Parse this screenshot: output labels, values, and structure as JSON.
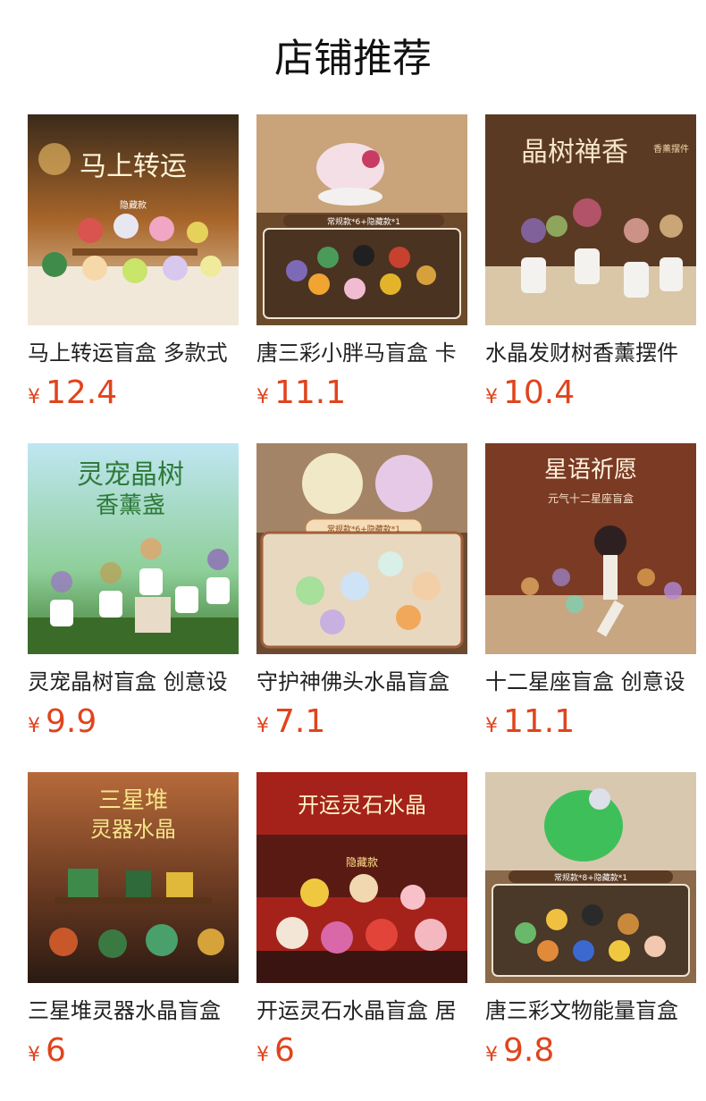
{
  "section": {
    "title": "店铺推荐"
  },
  "currency_symbol": "¥",
  "colors": {
    "price": "#e0441d",
    "title": "#111111",
    "name": "#222222"
  },
  "products": [
    {
      "name": "马上转运盲盒 多款式",
      "price": "12.4",
      "image_alt": "马上转运",
      "image_caption": "隐藏款",
      "image_icon": "horse-figurines-image"
    },
    {
      "name": "唐三彩小胖马盲盒 卡",
      "price": "11.1",
      "image_alt": "",
      "image_caption": "常规款*6+隐藏款*1",
      "image_icon": "tang-horse-figurines-image"
    },
    {
      "name": "水晶发财树香薰摆件",
      "price": "10.4",
      "image_alt": "晶树禅香",
      "image_caption": "香薰摆件",
      "image_icon": "crystal-tree-image"
    },
    {
      "name": "灵宠晶树盲盒 创意设",
      "price": "9.9",
      "image_alt": "灵宠晶树",
      "image_caption": "香薰盏",
      "image_icon": "pet-crystal-tree-image"
    },
    {
      "name": "守护神佛头水晶盲盒",
      "price": "7.1",
      "image_alt": "",
      "image_caption": "常规款*6+隐藏款*1",
      "image_icon": "buddha-crystal-image"
    },
    {
      "name": "十二星座盲盒 创意设",
      "price": "11.1",
      "image_alt": "星语祈愿",
      "image_caption": "元气十二星座盲盒",
      "image_icon": "zodiac-crystal-image"
    },
    {
      "name": "三星堆灵器水晶盲盒",
      "price": "6",
      "image_alt": "三星堆",
      "image_caption": "灵器水晶",
      "image_icon": "sanxingdui-image"
    },
    {
      "name": "开运灵石水晶盲盒 居",
      "price": "6",
      "image_alt": "开运灵石水晶",
      "image_caption": "隐藏款",
      "image_icon": "lucky-stone-image"
    },
    {
      "name": "唐三彩文物能量盲盒",
      "price": "9.8",
      "image_alt": "",
      "image_caption": "常规款*8+隐藏款*1",
      "image_icon": "tang-relic-image"
    }
  ]
}
